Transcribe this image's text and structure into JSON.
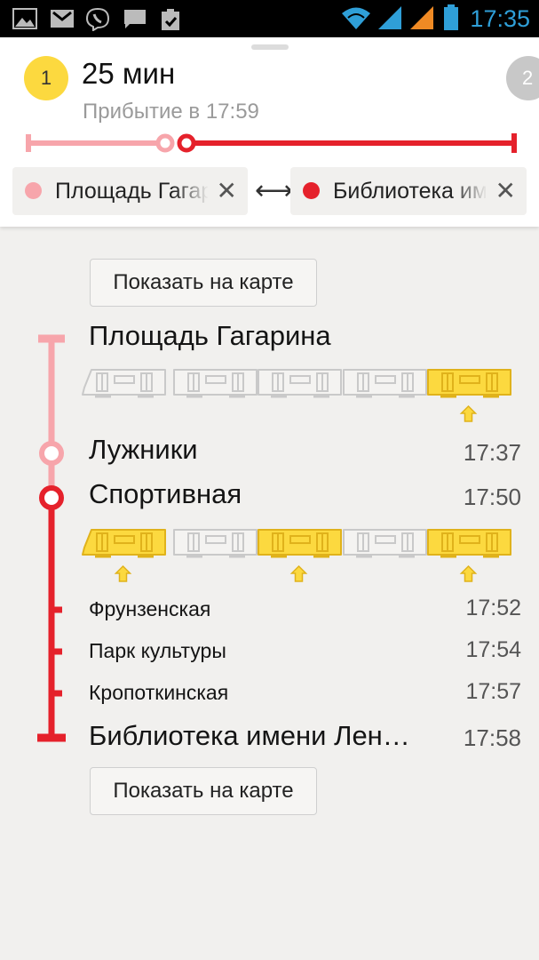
{
  "status_bar": {
    "time": "17:35"
  },
  "colors": {
    "accent_yellow": "#fcd93f",
    "line_pink": "#f7a5ab",
    "line_red": "#e5212b",
    "status_time": "#2f9fd8"
  },
  "route": {
    "number": "1",
    "next_number": "2",
    "duration": "25 мин",
    "arrival": "Прибытие в 17:59",
    "from": "Площадь Гагарина",
    "to": "Библиотека имени Ленина"
  },
  "buttons": {
    "show_on_map": "Показать на карте"
  },
  "stops": [
    {
      "name": "Площадь Гагарина",
      "time": ""
    },
    {
      "name": "Лужники",
      "time": "17:37"
    },
    {
      "name": "Спортивная",
      "time": "17:50"
    },
    {
      "name": "Фрунзенская",
      "time": "17:52"
    },
    {
      "name": "Парк культуры",
      "time": "17:54"
    },
    {
      "name": "Кропоткинская",
      "time": "17:57"
    },
    {
      "name": "Библиотека имени Лен…",
      "time": "17:58"
    }
  ],
  "trains": [
    {
      "best_cars": [
        5
      ]
    },
    {
      "best_cars": [
        1,
        3,
        5
      ]
    }
  ]
}
